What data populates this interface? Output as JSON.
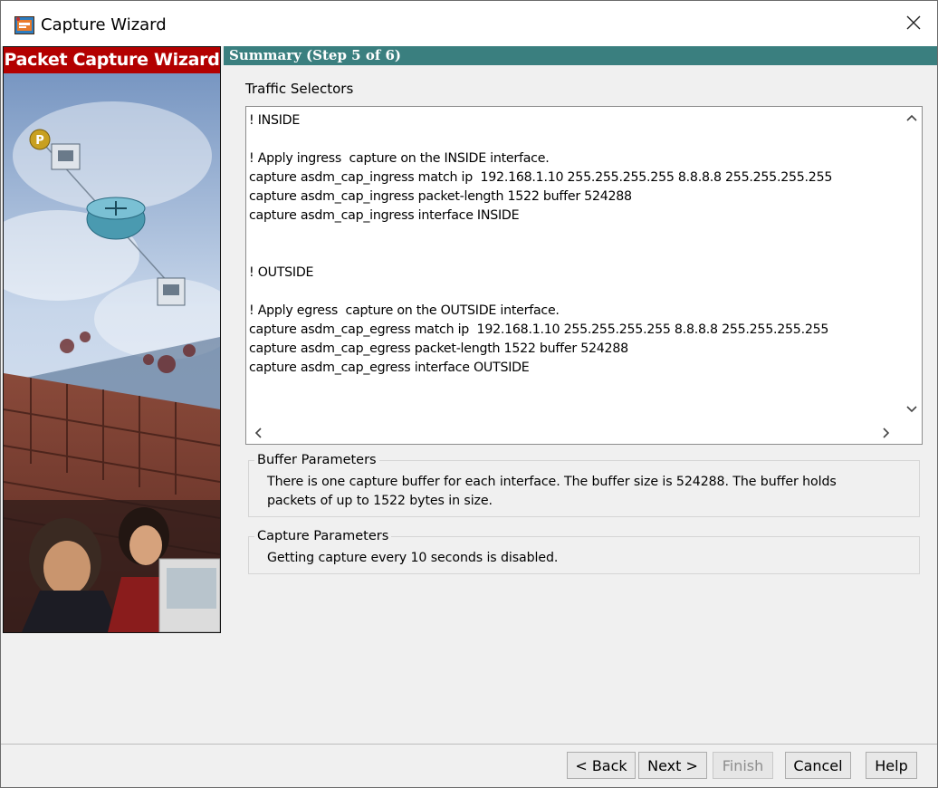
{
  "window": {
    "title": "Capture Wizard"
  },
  "sidebar": {
    "title": "Packet Capture Wizard"
  },
  "header": {
    "title": "Summary  (Step 5 of 6)"
  },
  "traffic": {
    "label": "Traffic Selectors",
    "lines": [
      "! INSIDE",
      "",
      "! Apply ingress  capture on the INSIDE interface.",
      "capture asdm_cap_ingress match ip  192.168.1.10 255.255.255.255 8.8.8.8 255.255.255.255",
      "capture asdm_cap_ingress packet-length 1522 buffer 524288",
      "capture asdm_cap_ingress interface INSIDE",
      "",
      "",
      "! OUTSIDE",
      "",
      "! Apply egress  capture on the OUTSIDE interface.",
      "capture asdm_cap_egress match ip  192.168.1.10 255.255.255.255 8.8.8.8 255.255.255.255",
      "capture asdm_cap_egress packet-length 1522 buffer 524288",
      "capture asdm_cap_egress interface OUTSIDE"
    ]
  },
  "buffer": {
    "legend": "Buffer Parameters",
    "line1": "There is one capture buffer for each interface. The buffer size is 524288. The buffer holds",
    "line2": "packets of up to 1522 bytes in size."
  },
  "capture": {
    "legend": "Capture Parameters",
    "text": "Getting capture every 10 seconds is disabled."
  },
  "buttons": {
    "back": "< Back",
    "next": "Next >",
    "finish": "Finish",
    "cancel": "Cancel",
    "help": "Help"
  }
}
